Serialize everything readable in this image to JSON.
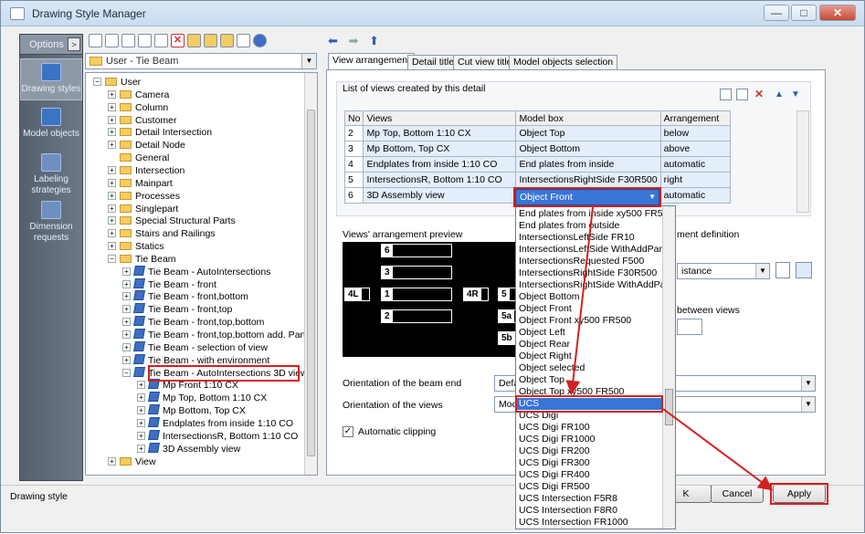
{
  "window": {
    "title": "Drawing Style Manager",
    "min": "—",
    "max": "□",
    "close": "✕"
  },
  "leftnav": {
    "options_label": "Options",
    "options_arrow": ">",
    "items": [
      {
        "label": "Drawing styles",
        "icon": "drawing-styles-icon"
      },
      {
        "label": "Model objects",
        "icon": "model-objects-icon"
      },
      {
        "label": "Labeling strategies",
        "icon": "labeling-icon"
      },
      {
        "label": "Dimension requests",
        "icon": "dimension-icon"
      }
    ]
  },
  "combo": {
    "value": "User - Tie Beam"
  },
  "tree": {
    "rows": [
      {
        "label": "User",
        "type": "folder",
        "indent": 0,
        "expander": "−"
      },
      {
        "label": "Camera",
        "type": "folder",
        "indent": 1,
        "expander": "+"
      },
      {
        "label": "Column",
        "type": "folder",
        "indent": 1,
        "expander": "+"
      },
      {
        "label": "Customer",
        "type": "folder",
        "indent": 1,
        "expander": "+"
      },
      {
        "label": "Detail Intersection",
        "type": "folder",
        "indent": 1,
        "expander": "+"
      },
      {
        "label": "Detail Node",
        "type": "folder",
        "indent": 1,
        "expander": "+"
      },
      {
        "label": "General",
        "type": "folder",
        "indent": 1,
        "expander": ""
      },
      {
        "label": "Intersection",
        "type": "folder",
        "indent": 1,
        "expander": "+"
      },
      {
        "label": "Mainpart",
        "type": "folder",
        "indent": 1,
        "expander": "+"
      },
      {
        "label": "Processes",
        "type": "folder",
        "indent": 1,
        "expander": "+"
      },
      {
        "label": "Singlepart",
        "type": "folder",
        "indent": 1,
        "expander": "+"
      },
      {
        "label": "Special Structural Parts",
        "type": "folder",
        "indent": 1,
        "expander": "+"
      },
      {
        "label": "Stairs and Railings",
        "type": "folder",
        "indent": 1,
        "expander": "+"
      },
      {
        "label": "Statics",
        "type": "folder",
        "indent": 1,
        "expander": "+"
      },
      {
        "label": "Tie Beam",
        "type": "folder",
        "indent": 1,
        "expander": "−"
      },
      {
        "label": "Tie Beam - AutoIntersections",
        "type": "view",
        "indent": 2,
        "expander": "+"
      },
      {
        "label": "Tie Beam - front",
        "type": "view",
        "indent": 2,
        "expander": "+"
      },
      {
        "label": "Tie Beam - front,bottom",
        "type": "view",
        "indent": 2,
        "expander": "+"
      },
      {
        "label": "Tie Beam - front,top",
        "type": "view",
        "indent": 2,
        "expander": "+"
      },
      {
        "label": "Tie Beam - front,top,bottom",
        "type": "view",
        "indent": 2,
        "expander": "+"
      },
      {
        "label": "Tie Beam - front,top,bottom add. Parts",
        "type": "view",
        "indent": 2,
        "expander": "+"
      },
      {
        "label": "Tie Beam - selection of view",
        "type": "view",
        "indent": 2,
        "expander": "+"
      },
      {
        "label": "Tie Beam - with environment",
        "type": "view",
        "indent": 2,
        "expander": "+"
      },
      {
        "label": "Tie Beam - AutoIntersections 3D view",
        "type": "view",
        "indent": 2,
        "expander": "−"
      },
      {
        "label": "Mp Front 1:10 CX",
        "type": "view",
        "indent": 3,
        "expander": "+"
      },
      {
        "label": "Mp Top, Bottom 1:10 CX",
        "type": "view",
        "indent": 3,
        "expander": "+"
      },
      {
        "label": "Mp Bottom, Top CX",
        "type": "view",
        "indent": 3,
        "expander": "+"
      },
      {
        "label": "Endplates from inside 1:10 CO",
        "type": "view",
        "indent": 3,
        "expander": "+"
      },
      {
        "label": "IntersectionsR, Bottom 1:10 CO",
        "type": "view",
        "indent": 3,
        "expander": "+"
      },
      {
        "label": "3D Assembly view",
        "type": "view",
        "indent": 3,
        "expander": "+"
      },
      {
        "label": "View",
        "type": "folder",
        "indent": 1,
        "expander": "+"
      }
    ]
  },
  "nav": {
    "back": "⬅",
    "forward": "➡",
    "up": "⬆"
  },
  "tabs": [
    "View arrangement",
    "Detail title",
    "Cut view title",
    "Model objects selection"
  ],
  "views_list": {
    "title": "List of views created by this detail",
    "headers": [
      "No",
      "Views",
      "Model box",
      "Arrangement"
    ],
    "rows": [
      [
        "2",
        "Mp Top, Bottom 1:10 CX",
        "Object Top",
        "below"
      ],
      [
        "3",
        "Mp Bottom, Top CX",
        "Object Bottom",
        "above"
      ],
      [
        "4",
        "Endplates from inside 1:10 CO",
        "End plates from inside",
        "automatic"
      ],
      [
        "5",
        "IntersectionsR, Bottom 1:10 CO",
        "IntersectionsRightSide F30R500",
        "right"
      ],
      [
        "6",
        "3D Assembly view",
        "",
        "automatic"
      ]
    ],
    "selected_model_box": "Object Front"
  },
  "preview": {
    "label": "Views' arrangement preview",
    "boxes": [
      "6",
      "3",
      "4L",
      "1",
      "4R",
      "5",
      "2",
      "5a",
      "5b"
    ]
  },
  "arrangement_definition_label": "ment definition",
  "distance_value": "istance",
  "between_views_label": "between views",
  "orientation_beam_end": {
    "label": "Orientation of the beam end",
    "value": "Defa"
  },
  "orientation_views": {
    "label": "Orientation of the views",
    "value": "Mod"
  },
  "automatic_clipping": {
    "label": "Automatic clipping",
    "checked": "✓"
  },
  "dropdown_options": [
    "End plates from inside xy500 FR500",
    "End plates from outside",
    "IntersectionsLeftSide FR10",
    "IntersectionsLeftSide WithAddPart",
    "IntersectionsRequested F500",
    "IntersectionsRightSide F30R500",
    "IntersectionsRightSide WithAddPa",
    "Object Bottom",
    "Object Front",
    "Object Front xy500 FR500",
    "Object Left",
    "Object Rear",
    "Object Right",
    "Object selected",
    "Object Top",
    "Object Top xy500 FR500",
    "UCS",
    "UCS Digi",
    "UCS Digi FR100",
    "UCS Digi FR1000",
    "UCS Digi FR200",
    "UCS Digi FR300",
    "UCS Digi FR400",
    "UCS Digi FR500",
    "UCS Intersection F5R8",
    "UCS Intersection F8R0",
    "UCS Intersection FR1000"
  ],
  "dropdown_selected_index": 16,
  "buttons": {
    "ok": "K",
    "cancel": "Cancel",
    "apply": "Apply"
  },
  "status": {
    "text": "Drawing style"
  },
  "colors": {
    "highlight": "#3875d7",
    "annotation_red": "#d42020"
  }
}
